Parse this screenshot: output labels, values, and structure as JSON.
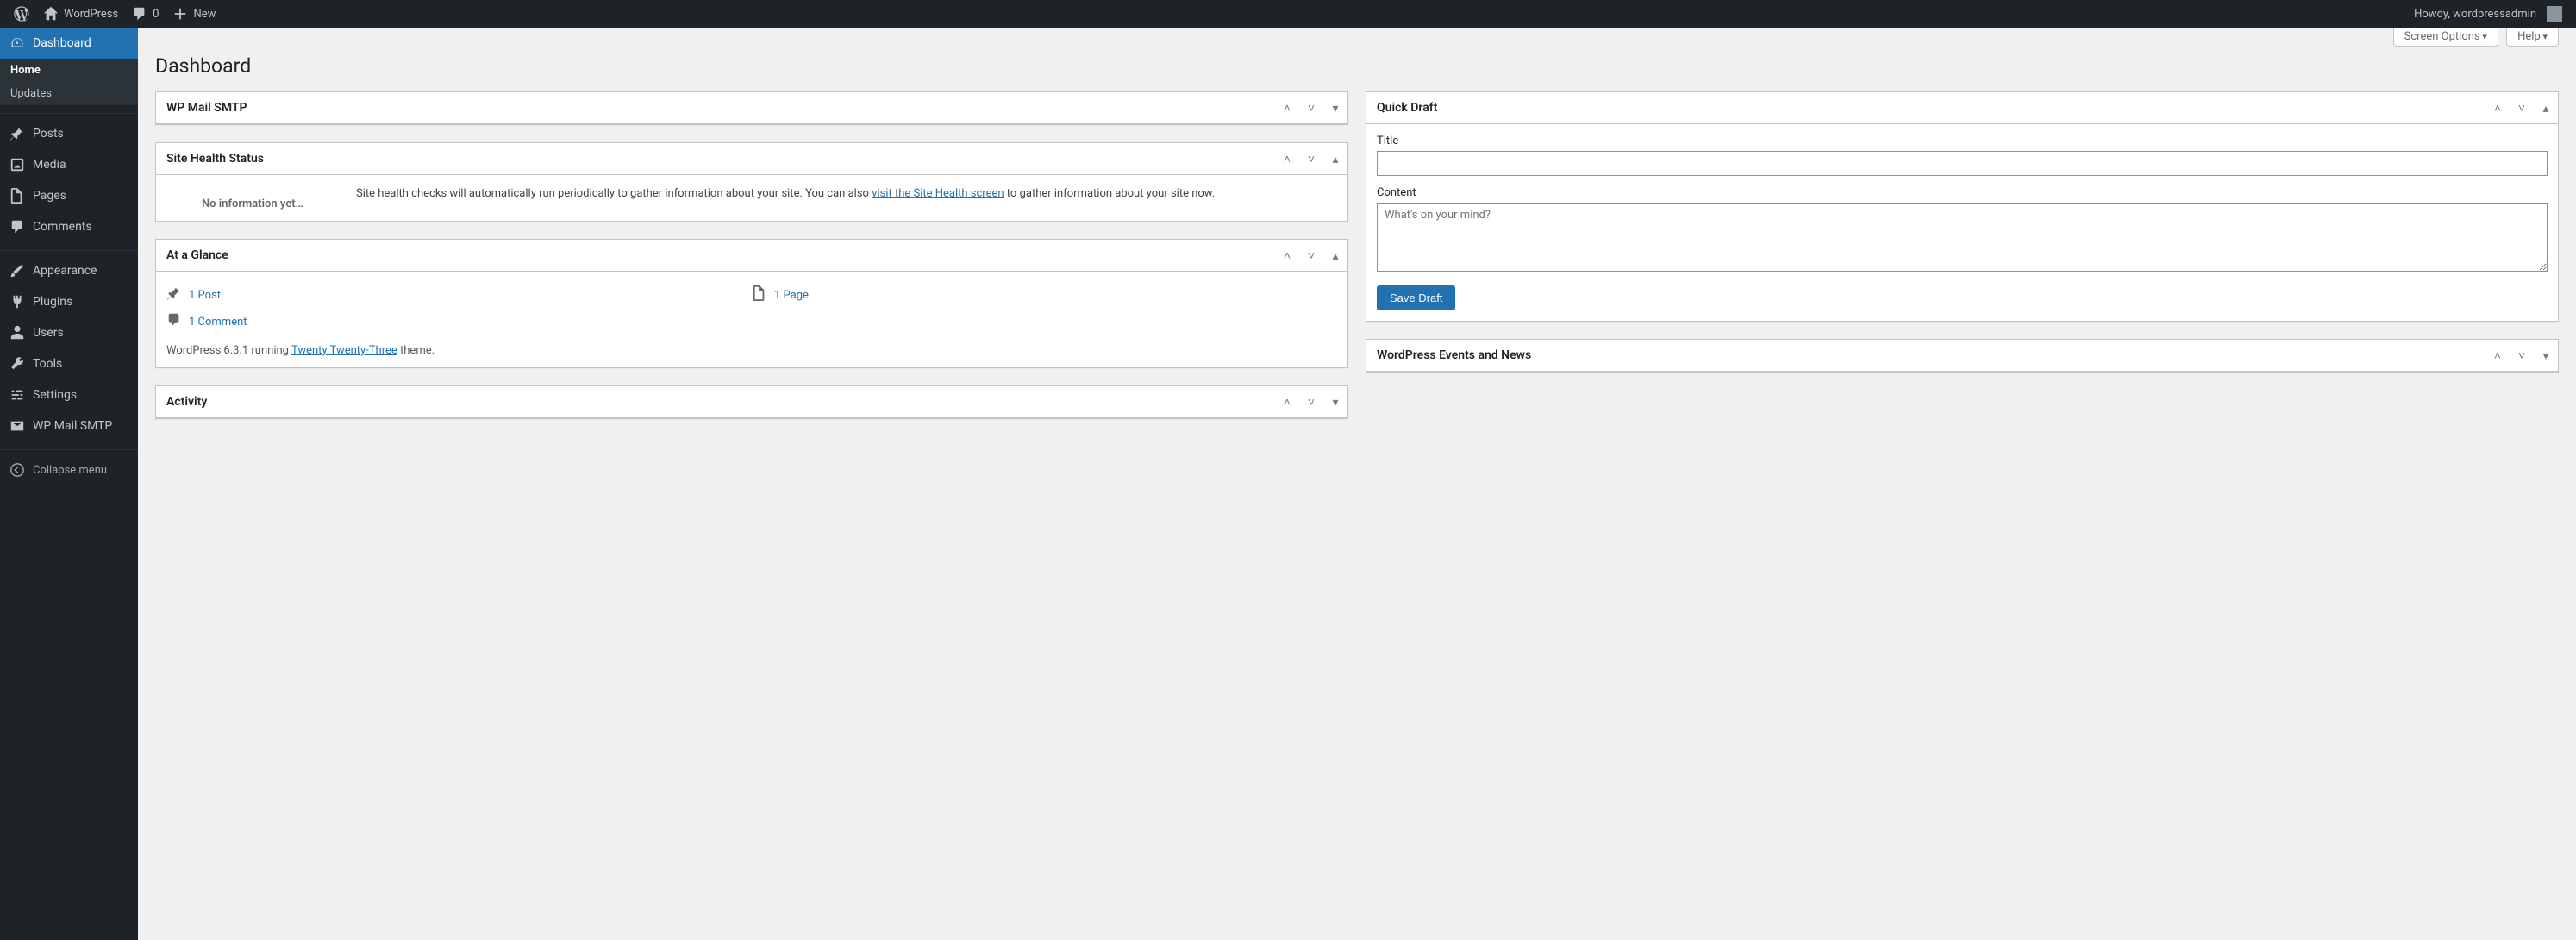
{
  "adminbar": {
    "site_name": "WordPress",
    "comments_count": "0",
    "new_label": "New",
    "howdy_prefix": "Howdy, ",
    "username": "wordpressadmin"
  },
  "menu": {
    "dashboard": "Dashboard",
    "dashboard_sub": {
      "home": "Home",
      "updates": "Updates"
    },
    "posts": "Posts",
    "media": "Media",
    "pages": "Pages",
    "comments": "Comments",
    "appearance": "Appearance",
    "plugins": "Plugins",
    "users": "Users",
    "tools": "Tools",
    "settings": "Settings",
    "wp_mail_smtp": "WP Mail SMTP",
    "collapse": "Collapse menu"
  },
  "page": {
    "title": "Dashboard",
    "screen_options": "Screen Options",
    "help": "Help"
  },
  "widgets": {
    "wp_mail_smtp": {
      "title": "WP Mail SMTP"
    },
    "site_health": {
      "title": "Site Health Status",
      "no_info": "No information yet…",
      "body_pre": "Site health checks will automatically run periodically to gather information about your site. You can also ",
      "link": "visit the Site Health screen",
      "body_post": " to gather information about your site now."
    },
    "at_a_glance": {
      "title": "At a Glance",
      "post": "1 Post",
      "page": "1 Page",
      "comment": "1 Comment",
      "footer_pre": "WordPress 6.3.1 running ",
      "theme": "Twenty Twenty-Three",
      "footer_post": " theme."
    },
    "activity": {
      "title": "Activity"
    },
    "quick_draft": {
      "title": "Quick Draft",
      "title_label": "Title",
      "content_label": "Content",
      "content_placeholder": "What's on your mind?",
      "save": "Save Draft"
    },
    "events_news": {
      "title": "WordPress Events and News"
    }
  }
}
